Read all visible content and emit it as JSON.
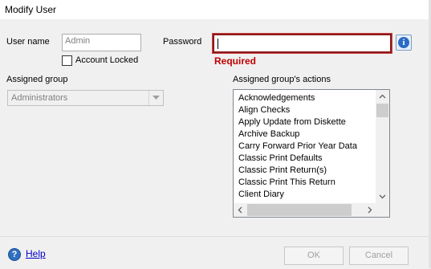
{
  "window": {
    "title": "Modify User"
  },
  "form": {
    "username_label": "User name",
    "username_value": "Admin",
    "password_label": "Password",
    "password_value": "",
    "required_text": "Required",
    "info_icon": "info-icon",
    "account_locked_label": "Account Locked",
    "account_locked_checked": false,
    "assigned_group_label": "Assigned group",
    "assigned_group_value": "Administrators",
    "actions_label": "Assigned group's actions",
    "actions": [
      "Acknowledgements",
      "Align Checks",
      "Apply Update from Diskette",
      "Archive Backup",
      "Carry Forward Prior Year Data",
      "Classic Print Defaults",
      "Classic Print Return(s)",
      "Classic Print This Return",
      "Client Diary"
    ]
  },
  "footer": {
    "help_label": "Help",
    "ok_label": "OK",
    "cancel_label": "Cancel"
  },
  "colors": {
    "required": "#c00000",
    "link": "#0000cc",
    "password_border": "#8b1a1a"
  }
}
